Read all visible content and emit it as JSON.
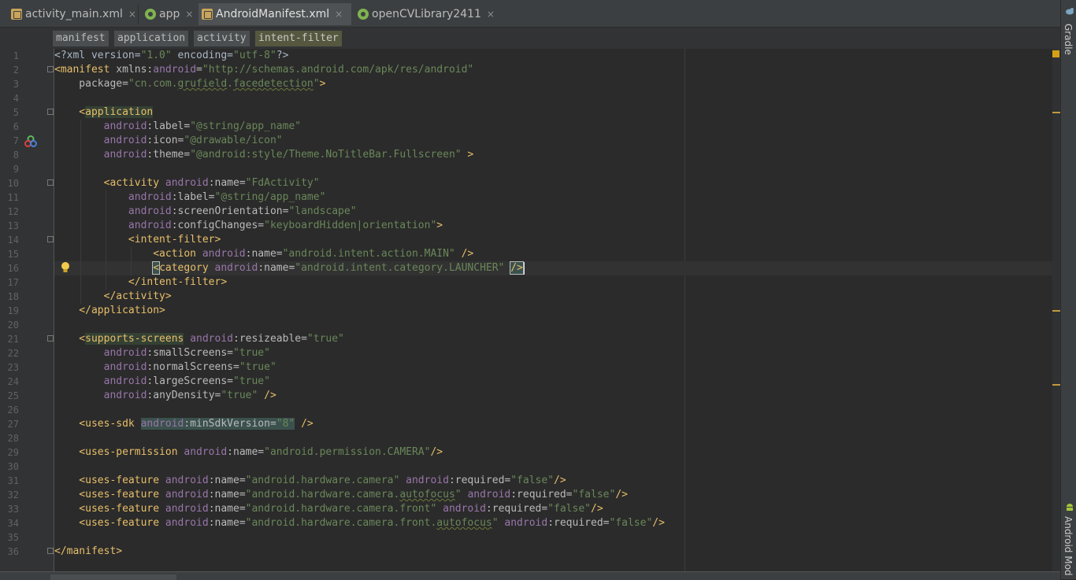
{
  "tabs": [
    {
      "label": "activity_main.xml",
      "icon": "xml-file-icon",
      "active": false
    },
    {
      "label": "app",
      "icon": "android-module-icon",
      "active": false
    },
    {
      "label": "AndroidManifest.xml",
      "icon": "xml-file-icon",
      "active": true
    },
    {
      "label": "openCVLibrary2411",
      "icon": "android-module-icon",
      "active": false
    }
  ],
  "tab_close_glyph": "×",
  "breadcrumb": [
    "manifest",
    "application",
    "activity",
    "intent-filter"
  ],
  "side_tools": {
    "top": "Gradle",
    "bottom": "Android Mod"
  },
  "line_numbers": [
    "1",
    "2",
    "3",
    "4",
    "5",
    "6",
    "7",
    "8",
    "9",
    "10",
    "11",
    "12",
    "13",
    "14",
    "15",
    "16",
    "17",
    "18",
    "19",
    "20",
    "21",
    "22",
    "23",
    "24",
    "25",
    "26",
    "27",
    "28",
    "29",
    "30",
    "31",
    "32",
    "33",
    "34",
    "35",
    "36"
  ],
  "code": {
    "l1": [
      "<?xml version=",
      "\"1.0\"",
      " encoding=",
      "\"utf-8\"",
      "?>"
    ],
    "l2": [
      "<manifest",
      " xmlns:",
      "android",
      "=",
      "\"http://schemas.android.com/apk/res/android\""
    ],
    "l3": [
      "    package=",
      "\"cn.com.",
      "grufield",
      ".",
      "facedetection",
      "\"",
      ">"
    ],
    "l5": [
      "    <",
      "application"
    ],
    "l6": [
      "        ",
      "android",
      ":label=",
      "\"@string/app_name\""
    ],
    "l7": [
      "        ",
      "android",
      ":icon=",
      "\"@drawable/icon\""
    ],
    "l8": [
      "        ",
      "android",
      ":theme=",
      "\"@android:style/Theme.NoTitleBar.Fullscreen\"",
      " >"
    ],
    "l10": [
      "        <activity ",
      "android",
      ":name=",
      "\"FdActivity\""
    ],
    "l11": [
      "            ",
      "android",
      ":label=",
      "\"@string/app_name\""
    ],
    "l12": [
      "            ",
      "android",
      ":screenOrientation=",
      "\"landscape\""
    ],
    "l13": [
      "            ",
      "android",
      ":configChanges=",
      "\"keyboardHidden|orientation\"",
      ">"
    ],
    "l14": [
      "            <intent-filter>"
    ],
    "l15": [
      "                <action ",
      "android",
      ":name=",
      "\"android.intent.action.MAIN\"",
      " />"
    ],
    "l16": [
      "                ",
      "<",
      "category ",
      "android",
      ":name=",
      "\"android.intent.category.LAUNCHER\"",
      " ",
      "/>"
    ],
    "l17": [
      "            </intent-filter>"
    ],
    "l18": [
      "        </activity>"
    ],
    "l19": [
      "    </application>"
    ],
    "l21": [
      "    <",
      "supports-screens",
      " ",
      "android",
      ":resizeable=",
      "\"true\""
    ],
    "l22": [
      "        ",
      "android",
      ":smallScreens=",
      "\"true\""
    ],
    "l23": [
      "        ",
      "android",
      ":normalScreens=",
      "\"true\""
    ],
    "l24": [
      "        ",
      "android",
      ":largeScreens=",
      "\"true\""
    ],
    "l25": [
      "        ",
      "android",
      ":anyDensity=",
      "\"true\"",
      " />"
    ],
    "l27": [
      "    <uses-sdk ",
      "android",
      ":minSdkVersion=",
      "\"8\"",
      " />"
    ],
    "l29": [
      "    <uses-permission ",
      "android",
      ":name=",
      "\"android.permission.CAMERA\"",
      "/>"
    ],
    "l31": [
      "    <uses-feature ",
      "android",
      ":name=",
      "\"android.hardware.camera\"",
      " ",
      "android",
      ":required=",
      "\"false\"",
      "/>"
    ],
    "l32": [
      "    <uses-feature ",
      "android",
      ":name=",
      "\"android.hardware.camera.",
      "autofocus",
      "\"",
      " ",
      "android",
      ":required=",
      "\"false\"",
      "/>"
    ],
    "l33": [
      "    <uses-feature ",
      "android",
      ":name=",
      "\"android.hardware.camera.front\"",
      " ",
      "android",
      ":required=",
      "\"false\"",
      "/>"
    ],
    "l34": [
      "    <uses-feature ",
      "android",
      ":name=",
      "\"android.hardware.camera.front.",
      "autofocus",
      "\"",
      " ",
      "android",
      ":required=",
      "\"false\"",
      "/>"
    ],
    "l36": [
      "</manifest>"
    ]
  },
  "colors": {
    "tag": "#e8bf6a",
    "namespace": "#9876aa",
    "value": "#6a8759",
    "text": "#a9b7c6",
    "background": "#2b2b2b"
  }
}
